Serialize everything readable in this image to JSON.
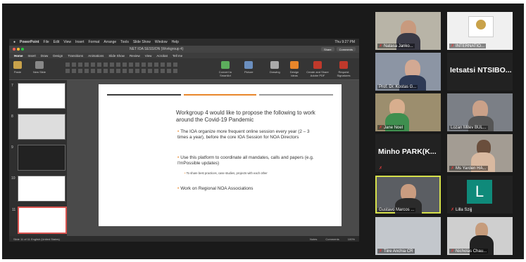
{
  "menubar": {
    "app": "PowerPoint",
    "items": [
      "File",
      "Edit",
      "View",
      "Insert",
      "Format",
      "Arrange",
      "Tools",
      "Slide Show",
      "Window",
      "Help"
    ],
    "status": "Thu 9:27 PM"
  },
  "window": {
    "title": "NET IOA SESSION (Workgroup 4)",
    "share_label": "Share",
    "comments_label": "Comments"
  },
  "ribbon": {
    "tabs": [
      "Home",
      "Insert",
      "Draw",
      "Design",
      "Transitions",
      "Animations",
      "Slide Show",
      "Review",
      "View",
      "Acrobat",
      "Tell me"
    ],
    "groups": [
      "Paste",
      "New Slide",
      "Convert to SmartArt",
      "Picture",
      "Drawing",
      "Design Ideas",
      "Create and Share Adobe PDF",
      "Request Signatures"
    ]
  },
  "thumbnails": [
    "7",
    "8",
    "9",
    "10",
    "11"
  ],
  "slide": {
    "title": "Workgroup 4 would like to propose the following to work around the Covid-19 Pandemic",
    "bullets": [
      "The IOA organize more frequent online session every year (2 – 3 times a year), before the core IOA Session for NOA Directors",
      "Use this platform to coordinate all mandates, calls and papers (e.g. I'mPossible updates)",
      "Work on Regional NOA Associations"
    ],
    "sub_bullet": "To share best practices, case studies, projects with each other",
    "rule_colors": [
      "#3a3a3a",
      "#e8862a",
      "#9a9a9a"
    ]
  },
  "statusbar": {
    "left": "Slide 11 of 11   English (United States)",
    "notes": "Notes",
    "comments": "Comments",
    "zoom": "100%"
  },
  "participants": [
    {
      "name": "Natasa Janko...",
      "type": "video"
    },
    {
      "name": "INTERNATIO...",
      "type": "video"
    },
    {
      "name": "Prof. Dr. Kostas G...",
      "type": "video"
    },
    {
      "name": "Ietsatsi  NTSIBO...",
      "type": "name"
    },
    {
      "name": "Jane Noel",
      "type": "video"
    },
    {
      "name": "Lozan Mitev BUL...",
      "type": "video"
    },
    {
      "name": "Minho  PARK(K...",
      "type": "name"
    },
    {
      "name": "Ms Yarden HA...",
      "type": "video"
    },
    {
      "name": "Gustavo Marcos ...",
      "type": "video",
      "active": true
    },
    {
      "name": "Lilla Szijj",
      "type": "avatar",
      "initial": "L"
    },
    {
      "name": "Tiire Anchia CR",
      "type": "video"
    },
    {
      "name": "Nicholas Chau...",
      "type": "video"
    }
  ],
  "colors": {
    "mic_muted": "#e23b3b",
    "active_speaker": "#d6e04a",
    "avatar_bg": "#0f8a7a",
    "accent": "#e8862a"
  }
}
